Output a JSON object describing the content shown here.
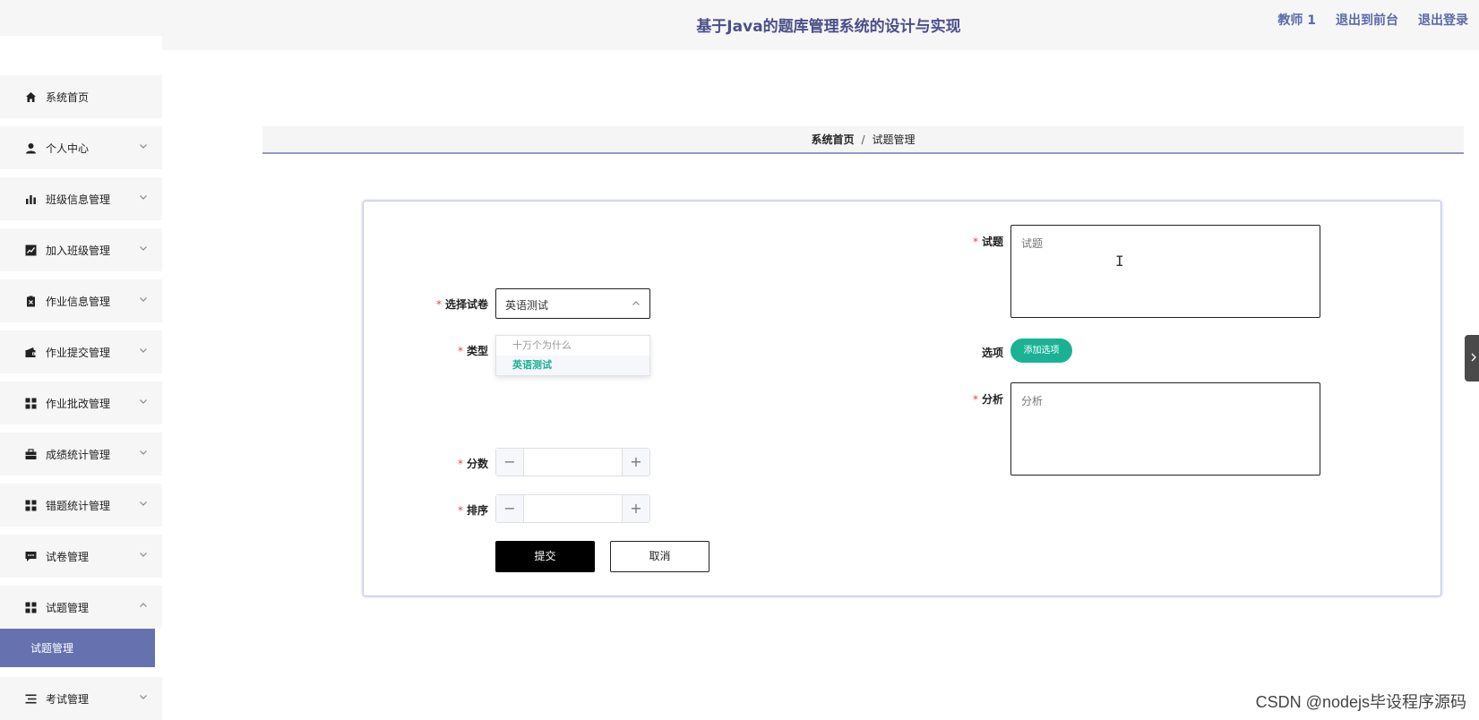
{
  "header": {
    "title": "基于Java的题库管理系统的设计与实现",
    "user_name": "教师 1",
    "back_to_front": "退出到前台",
    "logout": "退出登录"
  },
  "sidebar": {
    "items": [
      {
        "label": "系统首页",
        "icon": "home-icon"
      },
      {
        "label": "个人中心",
        "icon": "user-icon"
      },
      {
        "label": "班级信息管理",
        "icon": "bar-chart-icon"
      },
      {
        "label": "加入班级管理",
        "icon": "line-chart-icon"
      },
      {
        "label": "作业信息管理",
        "icon": "clipboard-icon"
      },
      {
        "label": "作业提交管理",
        "icon": "wallet-icon"
      },
      {
        "label": "作业批改管理",
        "icon": "grid-icon"
      },
      {
        "label": "成绩统计管理",
        "icon": "briefcase-icon"
      },
      {
        "label": "错题统计管理",
        "icon": "grid-icon"
      },
      {
        "label": "试卷管理",
        "icon": "message-icon"
      },
      {
        "label": "试题管理",
        "icon": "grid-icon"
      },
      {
        "label": "考试管理",
        "icon": "list-icon"
      }
    ],
    "active_submenu": "试题管理"
  },
  "breadcrumb": {
    "home": "系统首页",
    "separator": "/",
    "current": "试题管理"
  },
  "form": {
    "paper_label": "选择试卷",
    "paper_value": "英语测试",
    "paper_options": [
      "十万个为什么",
      "英语测试"
    ],
    "type_label": "类型",
    "score_label": "分数",
    "order_label": "排序",
    "question_label": "试题",
    "question_placeholder": "试题",
    "options_label": "选项",
    "add_option_button": "添加选项",
    "analysis_label": "分析",
    "analysis_placeholder": "分析",
    "submit": "提交",
    "cancel": "取消",
    "minus": "−",
    "plus": "+"
  },
  "watermark": "CSDN @nodejs毕设程序源码",
  "colors": {
    "accent": "#6672b0",
    "title": "#4a4f8a",
    "green": "#19b394",
    "required": "#e64545"
  }
}
